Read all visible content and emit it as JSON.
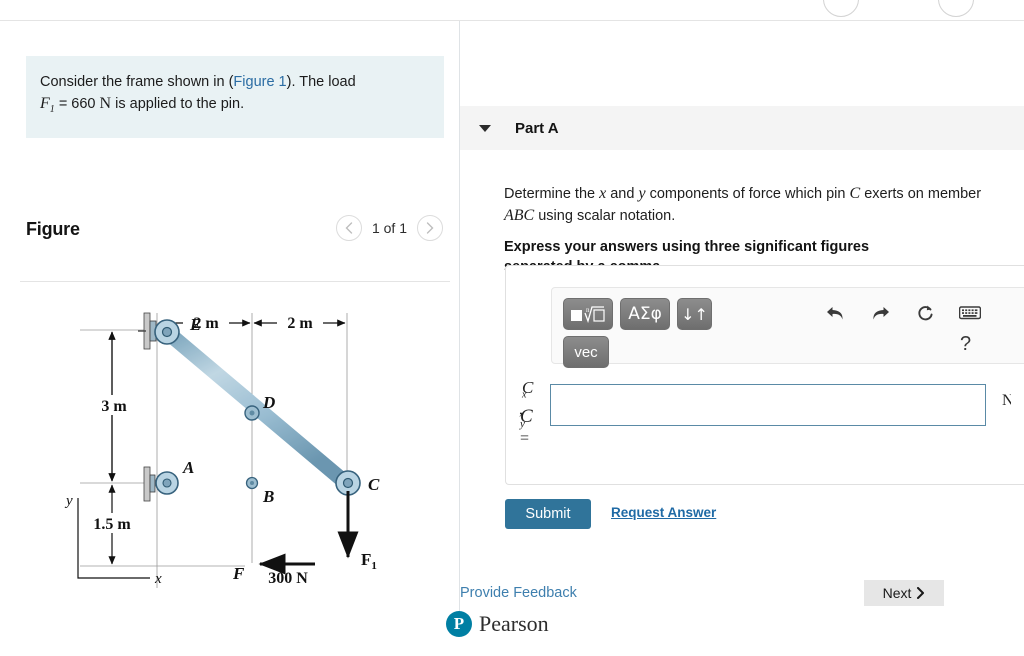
{
  "prompt": {
    "line1_a": "Consider the frame shown in (",
    "link": "Figure 1",
    "line1_b": "). The load",
    "force_sym": "F",
    "force_sub": "1",
    "force_eq": "= 660",
    "force_unit": "N",
    "line2_tail": "is applied to the pin."
  },
  "figure": {
    "title": "Figure",
    "counter": "1 of 1",
    "prev_icon": "chevron-left-icon",
    "next_icon": "chevron-right-icon",
    "diagram": {
      "labels": {
        "A": "A",
        "B": "B",
        "C": "C",
        "D": "D",
        "E": "E",
        "F": "F"
      },
      "dimensions": {
        "top_left": "2 m",
        "top_right": "2 m",
        "vertical_upper": "3 m",
        "vertical_lower": "1.5 m"
      },
      "axes": {
        "x": "x",
        "y": "y"
      },
      "forces": {
        "horizontal": "300 N",
        "vertical_sym": "F",
        "vertical_sub": "1"
      }
    }
  },
  "part": {
    "label": "Part A",
    "caret_icon": "caret-down-icon",
    "question_pre": "Determine the ",
    "question_x": "x",
    "question_mid1": " and ",
    "question_y": "y",
    "question_mid2": " components of force which pin ",
    "question_c": "C",
    "question_mid3": " exerts on member ",
    "question_abc": "ABC",
    "question_end": " using scalar notation.",
    "instruction": "Express your answers using three significant figures separated by a comma."
  },
  "toolbar": {
    "sqrt_button": "□ⁿ√□",
    "greek_button": "ΑΣφ",
    "updown_button": "↓↑",
    "vec_button": "vec",
    "undo_icon": "undo-arrow-icon",
    "redo_icon": "redo-arrow-icon",
    "reset_icon": "reset-circular-arrow-icon",
    "keyboard_icon": "keyboard-icon",
    "help_label": "?"
  },
  "answer": {
    "label_cx": "C",
    "label_cx_sub": "x",
    "label_comma": ",",
    "label_cy": "C",
    "label_cy_sub": "y",
    "label_equals": "=",
    "value": "",
    "placeholder": "",
    "unit": "N"
  },
  "actions": {
    "submit": "Submit",
    "request_answer": "Request Answer",
    "provide_feedback": "Provide Feedback",
    "next": "Next",
    "next_icon": "chevron-right-icon"
  },
  "brand": {
    "mark": "P",
    "name": "Pearson"
  },
  "colors": {
    "accent": "#30749a",
    "link": "#1f6aa5",
    "prompt_bg": "#e9f2f4",
    "part_bg": "#f4f4f4",
    "brand": "#007fa3"
  }
}
